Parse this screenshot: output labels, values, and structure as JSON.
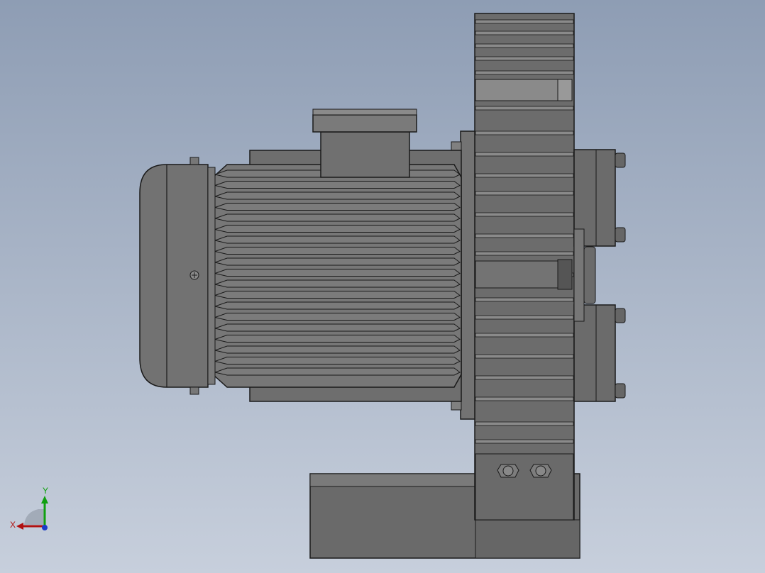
{
  "viewport": {
    "background_top": "#8e9db4",
    "background_bottom": "#c7cfdc"
  },
  "model": {
    "body_color": "#6f6f6f",
    "fin_color": "#7b7b7b",
    "edge_color": "#1a1a1a"
  },
  "triad": {
    "x_label": "X",
    "y_label": "Y",
    "x_color": "#b01010",
    "y_color": "#10a010",
    "z_color": "#1a3cc8"
  }
}
